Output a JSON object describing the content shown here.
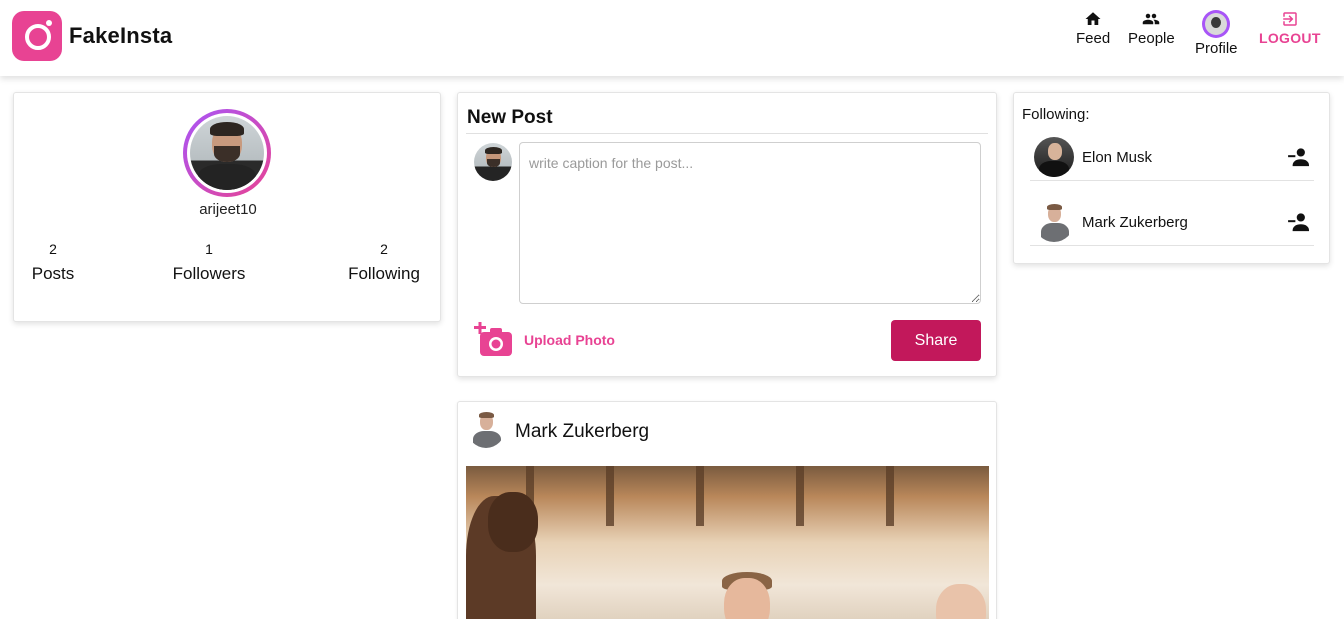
{
  "app": {
    "name": "FakeInsta"
  },
  "nav": {
    "feed": "Feed",
    "people": "People",
    "profile": "Profile",
    "logout": "LOGOUT"
  },
  "profile": {
    "username": "arijeet10",
    "stats": [
      {
        "label": "Posts",
        "value": "2"
      },
      {
        "label": "Followers",
        "value": "1"
      },
      {
        "label": "Following",
        "value": "2"
      }
    ]
  },
  "new_post": {
    "title": "New Post",
    "caption_placeholder": "write caption for the post...",
    "upload_label": "Upload Photo",
    "share_label": "Share"
  },
  "following": {
    "title": "Following:",
    "items": [
      {
        "name": "Elon Musk"
      },
      {
        "name": "Mark Zukerberg"
      }
    ]
  },
  "feed": {
    "posts": [
      {
        "author": "Mark Zukerberg"
      }
    ]
  },
  "colors": {
    "accent": "#e84393",
    "share_button": "#c2185b",
    "avatar_ring": "#a855f7"
  }
}
